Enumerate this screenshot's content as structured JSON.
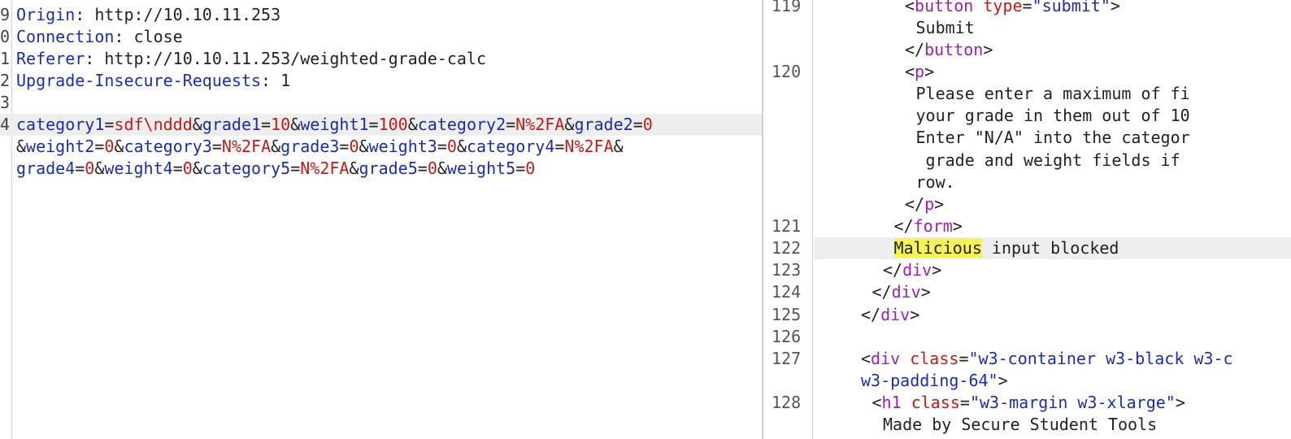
{
  "request": {
    "headers": [
      {
        "num": "9",
        "key": "Origin",
        "value": "http://10.10.11.253"
      },
      {
        "num": "0",
        "key": "Connection",
        "value": "close"
      },
      {
        "num": "1",
        "key": "Referer",
        "value": "http://10.10.11.253/weighted-grade-calc"
      },
      {
        "num": "2",
        "key": "Upgrade-Insecure-Requests",
        "value": "1"
      }
    ],
    "blank_num": "3",
    "body_num": "4",
    "body_lines": [
      [
        [
          "k",
          "category1"
        ],
        [
          "e",
          "="
        ],
        [
          "v",
          "sdf\\nddd"
        ],
        [
          "a",
          "&"
        ],
        [
          "k",
          "grade1"
        ],
        [
          "e",
          "="
        ],
        [
          "v",
          "10"
        ],
        [
          "a",
          "&"
        ],
        [
          "k",
          "weight1"
        ],
        [
          "e",
          "="
        ],
        [
          "v",
          "100"
        ],
        [
          "a",
          "&"
        ],
        [
          "k",
          "category2"
        ],
        [
          "e",
          "="
        ],
        [
          "v",
          "N%2FA"
        ],
        [
          "a",
          "&"
        ],
        [
          "k",
          "grade2"
        ],
        [
          "e",
          "="
        ],
        [
          "v",
          "0"
        ]
      ],
      [
        [
          "a",
          "&"
        ],
        [
          "k",
          "weight2"
        ],
        [
          "e",
          "="
        ],
        [
          "v",
          "0"
        ],
        [
          "a",
          "&"
        ],
        [
          "k",
          "category3"
        ],
        [
          "e",
          "="
        ],
        [
          "v",
          "N%2FA"
        ],
        [
          "a",
          "&"
        ],
        [
          "k",
          "grade3"
        ],
        [
          "e",
          "="
        ],
        [
          "v",
          "0"
        ],
        [
          "a",
          "&"
        ],
        [
          "k",
          "weight3"
        ],
        [
          "e",
          "="
        ],
        [
          "v",
          "0"
        ],
        [
          "a",
          "&"
        ],
        [
          "k",
          "category4"
        ],
        [
          "e",
          "="
        ],
        [
          "v",
          "N%2FA"
        ],
        [
          "a",
          "&"
        ]
      ],
      [
        [
          "k",
          "grade4"
        ],
        [
          "e",
          "="
        ],
        [
          "v",
          "0"
        ],
        [
          "a",
          "&"
        ],
        [
          "k",
          "weight4"
        ],
        [
          "e",
          "="
        ],
        [
          "v",
          "0"
        ],
        [
          "a",
          "&"
        ],
        [
          "k",
          "category5"
        ],
        [
          "e",
          "="
        ],
        [
          "v",
          "N%2FA"
        ],
        [
          "a",
          "&"
        ],
        [
          "k",
          "grade5"
        ],
        [
          "e",
          "="
        ],
        [
          "v",
          "0"
        ],
        [
          "a",
          "&"
        ],
        [
          "k",
          "weight5"
        ],
        [
          "e",
          "="
        ],
        [
          "v",
          "0"
        ]
      ]
    ]
  },
  "response": {
    "lines": [
      {
        "num": "119",
        "indent": 8,
        "tokens": [
          [
            "p",
            "<"
          ],
          [
            "t",
            "button"
          ],
          [
            "p",
            " "
          ],
          [
            "a",
            "type"
          ],
          [
            "p",
            "="
          ],
          [
            "s",
            "\"submit\""
          ],
          [
            "p",
            ">"
          ]
        ]
      },
      {
        "num": "",
        "indent": 9,
        "tokens": [
          [
            "p",
            "Submit"
          ]
        ]
      },
      {
        "num": "",
        "indent": 8,
        "tokens": [
          [
            "p",
            "</"
          ],
          [
            "t",
            "button"
          ],
          [
            "p",
            ">"
          ]
        ]
      },
      {
        "num": "120",
        "indent": 8,
        "tokens": [
          [
            "p",
            "<"
          ],
          [
            "t",
            "p"
          ],
          [
            "p",
            ">"
          ]
        ]
      },
      {
        "num": "",
        "indent": 9,
        "tokens": [
          [
            "p",
            "Please enter a maximum of fi"
          ]
        ]
      },
      {
        "num": "",
        "indent": 9,
        "tokens": [
          [
            "p",
            "your grade in them out of 10"
          ]
        ]
      },
      {
        "num": "",
        "indent": 9,
        "tokens": [
          [
            "p",
            "Enter \"N/A\" into the categor"
          ]
        ]
      },
      {
        "num": "",
        "indent": 9,
        "tokens": [
          [
            "p",
            " grade and weight fields if"
          ]
        ]
      },
      {
        "num": "",
        "indent": 9,
        "tokens": [
          [
            "p",
            "row."
          ]
        ]
      },
      {
        "num": "",
        "indent": 8,
        "tokens": [
          [
            "p",
            "</"
          ],
          [
            "t",
            "p"
          ],
          [
            "p",
            ">"
          ]
        ]
      },
      {
        "num": "121",
        "indent": 7,
        "tokens": [
          [
            "p",
            "</"
          ],
          [
            "t",
            "form"
          ],
          [
            "p",
            ">"
          ]
        ]
      },
      {
        "num": "122",
        "indent": 7,
        "active": true,
        "tokens": [
          [
            "m",
            "Malicious"
          ],
          [
            "p",
            " input blocked"
          ]
        ]
      },
      {
        "num": "123",
        "indent": 6,
        "tokens": [
          [
            "p",
            "</"
          ],
          [
            "t",
            "div"
          ],
          [
            "p",
            ">"
          ]
        ]
      },
      {
        "num": "124",
        "indent": 5,
        "tokens": [
          [
            "p",
            "</"
          ],
          [
            "t",
            "div"
          ],
          [
            "p",
            ">"
          ]
        ]
      },
      {
        "num": "125",
        "indent": 4,
        "tokens": [
          [
            "p",
            "</"
          ],
          [
            "t",
            "div"
          ],
          [
            "p",
            ">"
          ]
        ]
      },
      {
        "num": "126",
        "indent": 4,
        "tokens": []
      },
      {
        "num": "127",
        "indent": 4,
        "tokens": [
          [
            "p",
            "<"
          ],
          [
            "t",
            "div"
          ],
          [
            "p",
            " "
          ],
          [
            "a",
            "class"
          ],
          [
            "p",
            "="
          ],
          [
            "s",
            "\"w3-container w3-black w3-c"
          ]
        ]
      },
      {
        "num": "",
        "indent": 4,
        "tokens": [
          [
            "s",
            "w3-padding-64\""
          ],
          [
            "p",
            ">"
          ]
        ]
      },
      {
        "num": "128",
        "indent": 5,
        "tokens": [
          [
            "p",
            "<"
          ],
          [
            "t",
            "h1"
          ],
          [
            "p",
            " "
          ],
          [
            "a",
            "class"
          ],
          [
            "p",
            "="
          ],
          [
            "s",
            "\"w3-margin w3-xlarge\""
          ],
          [
            "p",
            ">"
          ]
        ]
      },
      {
        "num": "",
        "indent": 6,
        "tokens": [
          [
            "p",
            "Made by Secure Student Tools"
          ]
        ]
      }
    ]
  }
}
